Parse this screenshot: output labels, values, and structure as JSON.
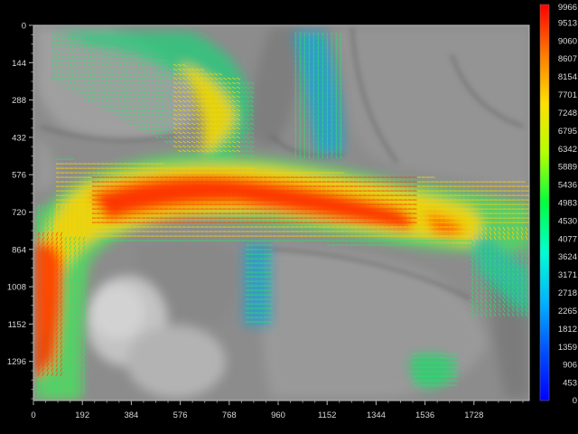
{
  "viewer": {
    "x_axis_ticks": [
      "0",
      "192",
      "384",
      "576",
      "768",
      "960",
      "1152",
      "1344",
      "1536",
      "1728"
    ],
    "y_axis_ticks": [
      "0",
      "144",
      "288",
      "432",
      "576",
      "720",
      "864",
      "1008",
      "1152",
      "1296"
    ],
    "colorbar_ticks": [
      "9966",
      "9513",
      "9060",
      "8607",
      "8154",
      "7701",
      "7248",
      "6795",
      "6342",
      "5889",
      "5436",
      "4983",
      "4530",
      "4077",
      "3624",
      "3171",
      "2718",
      "2265",
      "1812",
      "1359",
      "906",
      "453",
      "0"
    ],
    "colormap": [
      "#ff0000",
      "#ff7a00",
      "#ffe100",
      "#b4ff00",
      "#00ff3c",
      "#00ffd2",
      "#00b4ff",
      "#0050ff",
      "#0000ff"
    ],
    "background_color": "#000000"
  }
}
